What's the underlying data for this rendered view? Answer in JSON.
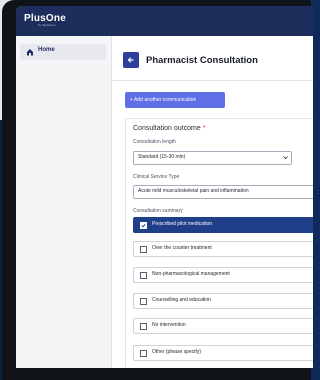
{
  "app": {
    "brand": "PlusOne",
    "brand_sub": "by Medicines"
  },
  "sidebar": {
    "items": [
      {
        "label": "Home",
        "icon": "home-icon",
        "active": true
      }
    ]
  },
  "header": {
    "title": "Pharmacist Consultation",
    "back_icon": "arrow-left-icon"
  },
  "actions": {
    "add_label": "+ Add another communication"
  },
  "consultation": {
    "section_title": "Consultation outcome",
    "required_mark": "*",
    "length_label": "Consultation length",
    "length_value": "Standard (15-30 min)",
    "service_label": "Clinical Service Type",
    "service_value": "Acute mild musculoskeletal pain and inflammation",
    "summary_label": "Consultation summary",
    "options": [
      {
        "label": "Prescribed pilot medication",
        "checked": true
      },
      {
        "label": "Over the counter treatment",
        "checked": false
      },
      {
        "label": "Non-pharmacological management",
        "checked": false
      },
      {
        "label": "Counselling and education",
        "checked": false
      },
      {
        "label": "No intervention",
        "checked": false
      },
      {
        "label": "Other (please specify)",
        "checked": false
      }
    ]
  },
  "colors": {
    "topbar": "#1d2d5c",
    "accent": "#2c3f99",
    "add_button": "#5f6fe6",
    "selected": "#1f3f88"
  }
}
